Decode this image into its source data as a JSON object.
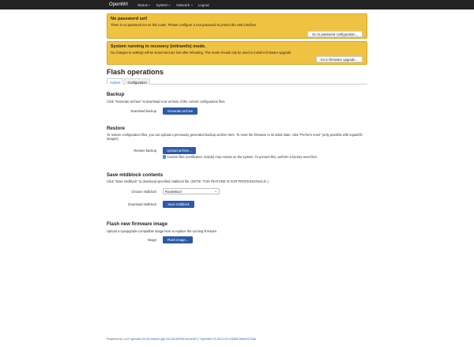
{
  "navbar": {
    "brand": "OpenWrt",
    "items": [
      {
        "label": "Status"
      },
      {
        "label": "System"
      },
      {
        "label": "Network"
      },
      {
        "label": "Logout"
      }
    ]
  },
  "alerts": {
    "no_password": {
      "title": "No password set!",
      "text": "There is no password set on this router. Please configure a root password to protect the web interface.",
      "button": "Go to password configuration..."
    },
    "recovery": {
      "title": "System running in recovery (initramfs) mode.",
      "text": "No changes to settings will be stored and are lost after rebooting. This mode should only be used to install a firmware upgrade.",
      "button": "Go to firmware upgrade..."
    }
  },
  "page": {
    "title": "Flash operations",
    "tabs": [
      "Actions",
      "Configuration"
    ]
  },
  "backup": {
    "title": "Backup",
    "description": "Click \"Generate archive\" to download a tar archive of the current configuration files.",
    "label": "Download backup",
    "button": "Generate archive"
  },
  "restore": {
    "title": "Restore",
    "description": "To restore configuration files, you can upload a previously generated backup archive here. To reset the firmware to its initial state, click \"Perform reset\" (only possible with squashfs images).",
    "label": "Restore backup",
    "button": "Upload archive...",
    "hint": "Custom files (certificates, scripts) may remain on the system. To prevent this, perform a factory-reset first."
  },
  "mtdblock": {
    "title": "Save mtdblock contents",
    "description": "Click \"Save mtdblock\" to download specified mtdblock file. (NOTE: THIS FEATURE IS FOR PROFESSIONALS! )",
    "choose_label": "Choose mtdblock",
    "selected": "RouterBoot",
    "download_label": "Download mtdblock",
    "button": "Save mtdblock"
  },
  "flash": {
    "title": "Flash new firmware image",
    "description": "Upload a sysupgrade-compatible image here to replace the running firmware.",
    "label": "Image",
    "button": "Flash image..."
  },
  "footer": {
    "powered_by": "Powered by",
    "luci_link": "LuCI openwrt-23.05 branch (git-23.218.60093-beco087)",
    "separator": "/",
    "openwrt_link": "OpenWrt 23.05.0-rc3 r23389-5deed175a5"
  },
  "colors": {
    "navbar_bg": "#222222",
    "alert_bg": "#f0c242",
    "primary_button": "#2c5aa8",
    "link": "#0069d6"
  }
}
